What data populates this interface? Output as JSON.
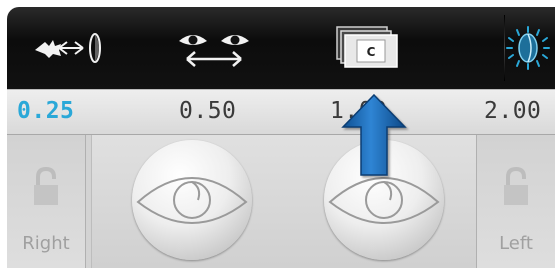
{
  "toolbar": {
    "buttons": [
      {
        "name": "eye-lens-distance-button",
        "icon": "eye-to-lens-icon"
      },
      {
        "name": "binocular-view-button",
        "icon": "two-eyes-arrow-icon"
      },
      {
        "name": "chart-cards-button",
        "icon": "chart-cards-icon",
        "card_letter": "C"
      },
      {
        "name": "lens-illumination-button",
        "icon": "lens-light-icon"
      }
    ]
  },
  "acuity": {
    "values": [
      "0.25",
      "0.50",
      "1.00",
      "2.00"
    ],
    "selected": "0.25",
    "selected_color": "#2aa8d8"
  },
  "eyes": {
    "right_label": "Right",
    "left_label": "Left"
  },
  "overlay": {
    "arrow_icon": "blue-up-arrow-icon",
    "arrow_color": "#1a63ad"
  }
}
